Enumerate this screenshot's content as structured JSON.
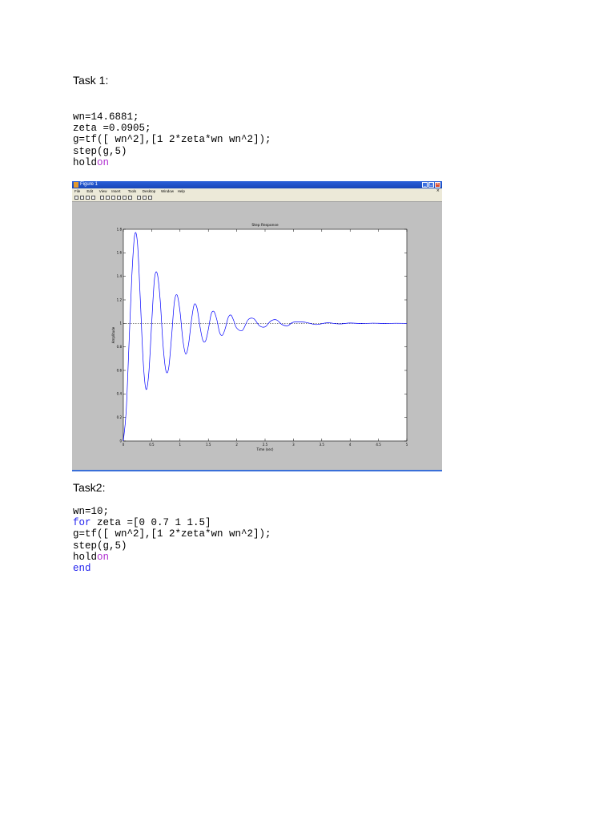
{
  "task1": {
    "heading": "Task 1:",
    "code": [
      [
        {
          "t": "wn=14.6881;",
          "c": ""
        }
      ],
      [
        {
          "t": "zeta =0.0905;",
          "c": ""
        }
      ],
      [
        {
          "t": "g=tf([ wn^2],[1 2*zeta*wn wn^2]);",
          "c": ""
        }
      ],
      [
        {
          "t": "step(g,5)",
          "c": ""
        }
      ],
      [
        {
          "t": "hold",
          "c": ""
        },
        {
          "t": "on",
          "c": "purple"
        }
      ]
    ]
  },
  "figure": {
    "window_title": "Figure 1",
    "menu": [
      "File",
      "Edit",
      "View",
      "Insert",
      "Tools",
      "Desktop",
      "Window",
      "Help"
    ],
    "toolbar_icons": [
      "new-file-icon",
      "open-folder-icon",
      "save-icon",
      "print-icon",
      "pointer-icon",
      "zoom-in-icon",
      "zoom-out-icon",
      "rotate-icon",
      "data-cursor-icon",
      "colorbar-icon",
      "legend-icon",
      "grid-icon",
      "plot-tools-icon"
    ]
  },
  "chart_data": {
    "type": "line",
    "title": "Step Response",
    "xlabel": "Time (sec)",
    "ylabel": "Amplitude",
    "xlim": [
      0,
      5
    ],
    "ylim": [
      0,
      1.8
    ],
    "xticks": [
      "0",
      "0.5",
      "1",
      "1.5",
      "2",
      "2.5",
      "3",
      "3.5",
      "4",
      "4.5",
      "5"
    ],
    "yticks": [
      "0",
      "0.2",
      "0.4",
      "0.6",
      "0.8",
      "1",
      "1.2",
      "1.4",
      "1.6",
      "1.8"
    ],
    "grid": false,
    "reference_line": 1,
    "series": [
      {
        "color": "#0000ff",
        "x": [
          0,
          0.05,
          0.1,
          0.15,
          0.2,
          0.25,
          0.3,
          0.35,
          0.4,
          0.45,
          0.5,
          0.55,
          0.6,
          0.65,
          0.7,
          0.75,
          0.8,
          0.85,
          0.9,
          0.95,
          1.0,
          1.05,
          1.1,
          1.15,
          1.2,
          1.25,
          1.3,
          1.35,
          1.4,
          1.45,
          1.5,
          1.55,
          1.6,
          1.65,
          1.7,
          1.75,
          1.8,
          1.85,
          1.9,
          1.95,
          2.0,
          2.1,
          2.2,
          2.3,
          2.4,
          2.5,
          2.6,
          2.7,
          2.8,
          2.9,
          3.0,
          3.2,
          3.4,
          3.6,
          3.8,
          4.0,
          4.2,
          4.4,
          4.6,
          4.8,
          5.0
        ],
        "y": [
          0,
          0.25,
          0.82,
          1.4,
          1.75,
          1.68,
          1.2,
          0.68,
          0.44,
          0.58,
          1.0,
          1.38,
          1.42,
          1.2,
          0.82,
          0.6,
          0.62,
          0.88,
          1.18,
          1.24,
          1.1,
          0.86,
          0.74,
          0.82,
          1.02,
          1.16,
          1.13,
          0.98,
          0.86,
          0.85,
          0.95,
          1.08,
          1.1,
          1.03,
          0.92,
          0.9,
          0.96,
          1.05,
          1.07,
          1.02,
          0.96,
          0.94,
          1.03,
          1.04,
          0.98,
          0.97,
          1.02,
          1.03,
          0.99,
          0.98,
          1.01,
          1.01,
          0.99,
          1.005,
          0.995,
          1.003,
          0.998,
          1.002,
          0.999,
          1.001,
          1.0
        ]
      }
    ]
  },
  "task2": {
    "heading": "Task2:",
    "code": [
      [
        {
          "t": "wn=10;",
          "c": ""
        }
      ],
      [
        {
          "t": "for",
          "c": "blue"
        },
        {
          "t": " zeta =[0 0.7 1 1.5]",
          "c": ""
        }
      ],
      [
        {
          "t": "g=tf([ wn^2],[1 2*zeta*wn wn^2]);",
          "c": ""
        }
      ],
      [
        {
          "t": "step(g,5)",
          "c": ""
        }
      ],
      [
        {
          "t": "hold",
          "c": ""
        },
        {
          "t": "on",
          "c": "purple"
        }
      ],
      [
        {
          "t": "end",
          "c": "blue"
        }
      ]
    ]
  }
}
